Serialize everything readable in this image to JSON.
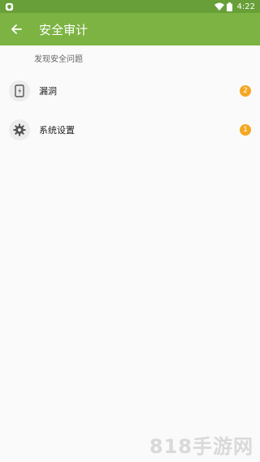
{
  "status_bar": {
    "time": "4:22",
    "notification_icon": "shield-notification-icon",
    "wifi_icon": "wifi-icon",
    "battery_icon": "battery-icon"
  },
  "app_bar": {
    "back_icon": "back-arrow-icon",
    "title": "安全审计"
  },
  "section": {
    "header": "发现安全问题"
  },
  "items": [
    {
      "label": "漏洞",
      "badge": "2",
      "icon": "phone-alert-icon"
    },
    {
      "label": "系统设置",
      "badge": "1",
      "icon": "gear-icon"
    }
  ],
  "watermark": "818手游网",
  "colors": {
    "status_bar": "#689f38",
    "app_bar": "#7cb342",
    "badge": "#f5a623",
    "background": "#fafafa"
  }
}
